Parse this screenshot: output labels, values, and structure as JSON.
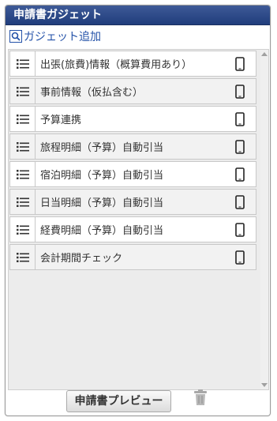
{
  "header": {
    "title": "申請書ガジェット"
  },
  "add_link": {
    "label": "ガジェット追加",
    "icon": "magnifier-icon"
  },
  "items": [
    {
      "label": "出張(旅費)情報（概算費用あり）",
      "device_icon": "smartphone-icon"
    },
    {
      "label": "事前情報（仮払含む）",
      "device_icon": "smartphone-icon"
    },
    {
      "label": "予算連携",
      "device_icon": "smartphone-icon"
    },
    {
      "label": "旅程明細（予算）自動引当",
      "device_icon": "smartphone-icon"
    },
    {
      "label": "宿泊明細（予算）自動引当",
      "device_icon": "smartphone-icon"
    },
    {
      "label": "日当明細（予算）自動引当",
      "device_icon": "smartphone-icon"
    },
    {
      "label": "経費明細（予算）自動引当",
      "device_icon": "smartphone-icon"
    },
    {
      "label": "会計期間チェック",
      "device_icon": "smartphone-icon"
    }
  ],
  "footer": {
    "preview_label": "申請書プレビュー",
    "delete_icon": "trash-icon"
  },
  "colors": {
    "header_bg": "#203d7c",
    "link": "#2351a8"
  }
}
